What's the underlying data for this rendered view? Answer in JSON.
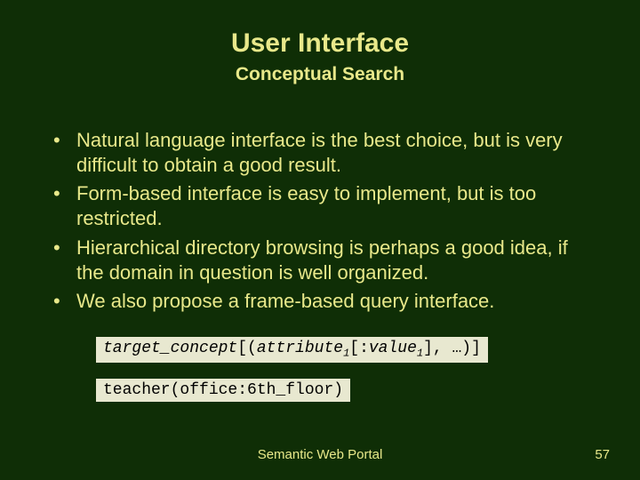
{
  "title": "User Interface",
  "subtitle": "Conceptual Search",
  "bullets": [
    "Natural language interface is the best choice, but is very difficult to obtain a good result.",
    "Form-based interface is easy to implement, but is too restricted.",
    "Hierarchical directory browsing is perhaps a good idea, if the domain in question is well organized.",
    "We also propose a frame-based query interface."
  ],
  "code1": {
    "t1": "target_concept",
    "t2": "[(",
    "t3": "attribute",
    "t4": "[:",
    "t5": "value",
    "t6": "], …)]"
  },
  "code2": "teacher(office:6th_floor)",
  "footer": "Semantic Web Portal",
  "pageNumber": "57"
}
